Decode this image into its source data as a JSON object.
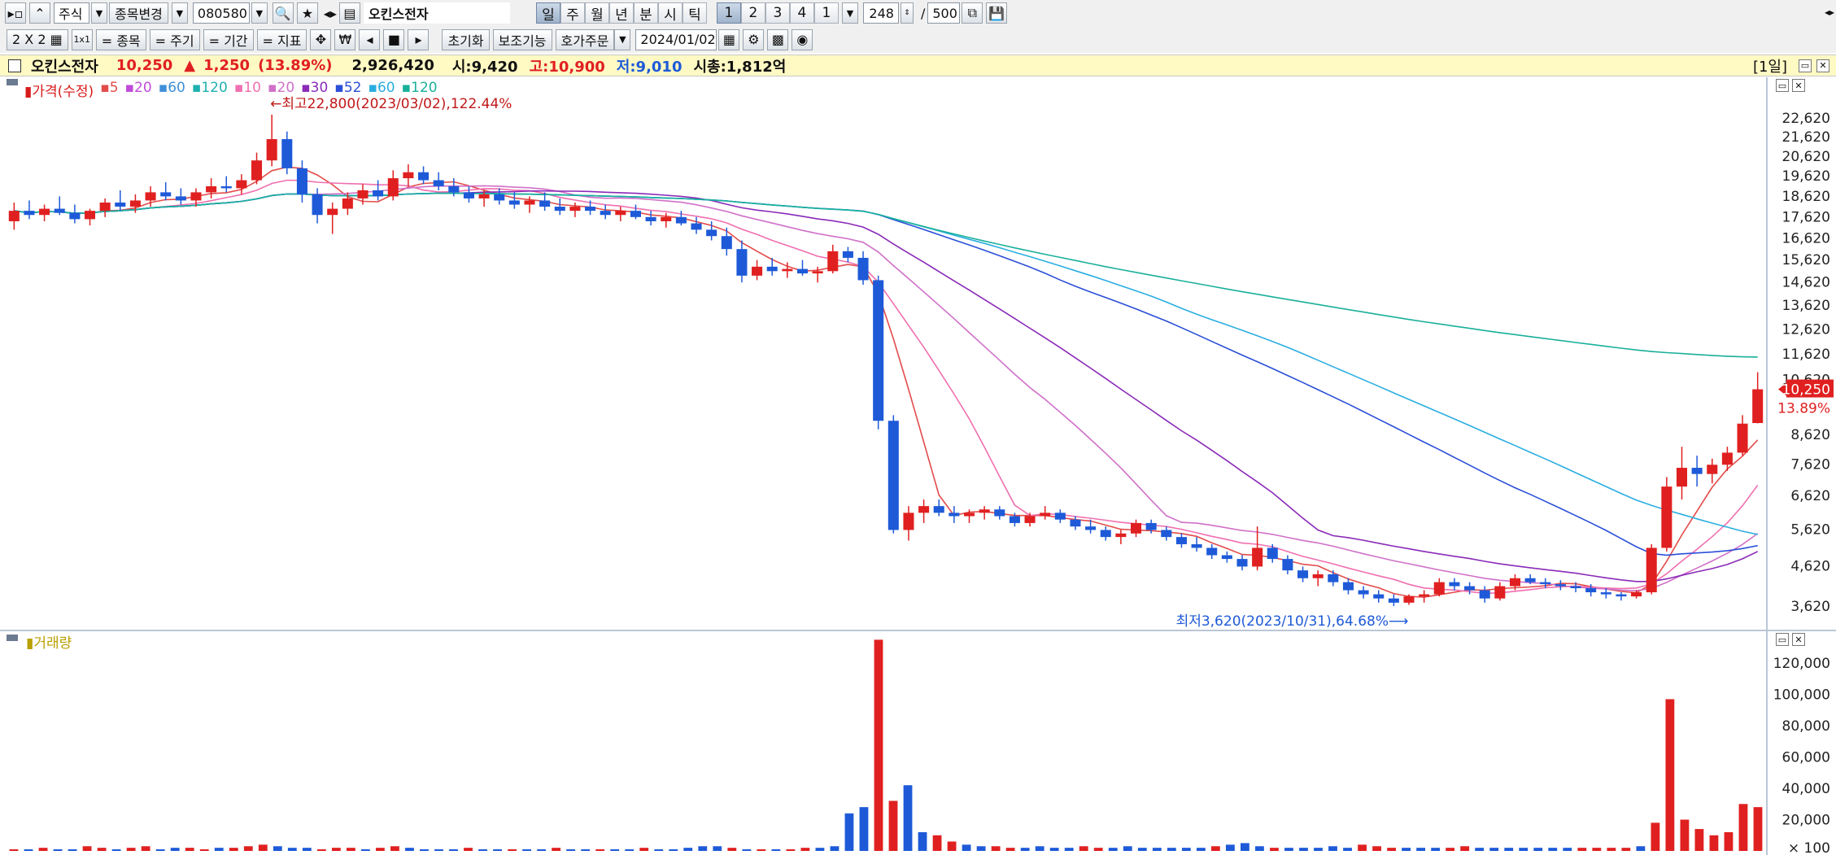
{
  "toolbar1": {
    "market": "주식",
    "change_label": "종목변경",
    "code": "080580",
    "stock_name": "오킨스전자",
    "periods": [
      "일",
      "주",
      "월",
      "년",
      "분",
      "시",
      "틱"
    ],
    "active_period": "일",
    "numbers": [
      "1",
      "2",
      "3",
      "4",
      "1"
    ],
    "active_number": "1",
    "count": "248",
    "slash": "/",
    "total": "500"
  },
  "toolbar2": {
    "layout_label": "2 X 2",
    "one_label": "1x1",
    "items": [
      "= 종목",
      "= 주기",
      "= 기간",
      "= 지표"
    ],
    "reset_label": "초기화",
    "aux_label": "보조기능",
    "order_label": "호가주문",
    "date": "2024/01/02"
  },
  "infobar": {
    "name": "오킨스전자",
    "price": "10,250",
    "arrow": "▲",
    "change": "1,250",
    "pct": "(13.89%)",
    "volume": "2,926,420",
    "open": "시:9,420",
    "high": "고:10,900",
    "low": "저:9,010",
    "mcap": "시총:1,812억",
    "period_tag": "[1일]"
  },
  "price_panel": {
    "legend": [
      {
        "text": "가격(수정)",
        "color": "#d81b1b"
      },
      {
        "text": "5",
        "color": "#e34b4b"
      },
      {
        "text": "20",
        "color": "#c04bd8"
      },
      {
        "text": "60",
        "color": "#3f8fd8"
      },
      {
        "text": "120",
        "color": "#20b0b0"
      },
      {
        "text": "10",
        "color": "#f06fb0"
      },
      {
        "text": "20",
        "color": "#d070c8"
      },
      {
        "text": "30",
        "color": "#8a2ab8"
      },
      {
        "text": "52",
        "color": "#2a4fd8"
      },
      {
        "text": "60",
        "color": "#2aaee0"
      },
      {
        "text": "120",
        "color": "#1ab09a"
      }
    ],
    "high_annotation": "최고22,800(2023/03/02),122.44%",
    "low_annotation": "최저3,620(2023/10/31),64.68%",
    "price_labels": [
      "22,620",
      "21,620",
      "20,620",
      "19,620",
      "18,620",
      "17,620",
      "16,620",
      "15,620",
      "14,620",
      "13,620",
      "12,620",
      "11,620",
      "10,620",
      "8,620",
      "7,620",
      "6,620",
      "5,620",
      "4,620",
      "3,620"
    ],
    "current_price": "10,250",
    "current_pct": "13.89%"
  },
  "volume_panel": {
    "title": "거래량",
    "labels": [
      "120,000",
      "100,000",
      "80,000",
      "60,000",
      "40,000",
      "20,000"
    ],
    "unit": "× 100"
  },
  "colors": {
    "up": "#e02020",
    "down": "#1e5ad8",
    "infobar_bg": "#fff9c4",
    "toolbar_bg": "#f0f0f0"
  },
  "chart_data": {
    "type": "candlestick",
    "candles": [
      {
        "o": 17400,
        "h": 18300,
        "l": 17000,
        "c": 17900
      },
      {
        "o": 17900,
        "h": 18400,
        "l": 17500,
        "c": 17700
      },
      {
        "o": 17700,
        "h": 18200,
        "l": 17400,
        "c": 18000
      },
      {
        "o": 18000,
        "h": 18600,
        "l": 17700,
        "c": 17800
      },
      {
        "o": 17800,
        "h": 18200,
        "l": 17300,
        "c": 17500
      },
      {
        "o": 17500,
        "h": 18000,
        "l": 17200,
        "c": 17900
      },
      {
        "o": 17900,
        "h": 18500,
        "l": 17600,
        "c": 18300
      },
      {
        "o": 18300,
        "h": 18900,
        "l": 17900,
        "c": 18100
      },
      {
        "o": 18100,
        "h": 18700,
        "l": 17800,
        "c": 18400
      },
      {
        "o": 18400,
        "h": 19100,
        "l": 18100,
        "c": 18800
      },
      {
        "o": 18800,
        "h": 19300,
        "l": 18400,
        "c": 18600
      },
      {
        "o": 18600,
        "h": 19000,
        "l": 18200,
        "c": 18400
      },
      {
        "o": 18400,
        "h": 19000,
        "l": 18100,
        "c": 18800
      },
      {
        "o": 18800,
        "h": 19500,
        "l": 18500,
        "c": 19100
      },
      {
        "o": 19100,
        "h": 19600,
        "l": 18800,
        "c": 19000
      },
      {
        "o": 19000,
        "h": 19700,
        "l": 18700,
        "c": 19400
      },
      {
        "o": 19400,
        "h": 20800,
        "l": 19200,
        "c": 20400
      },
      {
        "o": 20400,
        "h": 22800,
        "l": 20100,
        "c": 21500
      },
      {
        "o": 21500,
        "h": 21900,
        "l": 19700,
        "c": 20000
      },
      {
        "o": 20000,
        "h": 20400,
        "l": 18300,
        "c": 18700
      },
      {
        "o": 18700,
        "h": 19000,
        "l": 17300,
        "c": 17700
      },
      {
        "o": 17700,
        "h": 18300,
        "l": 16800,
        "c": 18000
      },
      {
        "o": 18000,
        "h": 18800,
        "l": 17700,
        "c": 18500
      },
      {
        "o": 18500,
        "h": 19200,
        "l": 18200,
        "c": 18900
      },
      {
        "o": 18900,
        "h": 19400,
        "l": 18400,
        "c": 18600
      },
      {
        "o": 18600,
        "h": 19900,
        "l": 18400,
        "c": 19500
      },
      {
        "o": 19500,
        "h": 20200,
        "l": 19100,
        "c": 19800
      },
      {
        "o": 19800,
        "h": 20100,
        "l": 19200,
        "c": 19400
      },
      {
        "o": 19400,
        "h": 19800,
        "l": 18900,
        "c": 19100
      },
      {
        "o": 19100,
        "h": 19500,
        "l": 18600,
        "c": 18800
      },
      {
        "o": 18800,
        "h": 19100,
        "l": 18300,
        "c": 18500
      },
      {
        "o": 18500,
        "h": 18900,
        "l": 18100,
        "c": 18700
      },
      {
        "o": 18700,
        "h": 19000,
        "l": 18200,
        "c": 18400
      },
      {
        "o": 18400,
        "h": 18800,
        "l": 18000,
        "c": 18200
      },
      {
        "o": 18200,
        "h": 18600,
        "l": 17800,
        "c": 18400
      },
      {
        "o": 18400,
        "h": 18800,
        "l": 17900,
        "c": 18100
      },
      {
        "o": 18100,
        "h": 18500,
        "l": 17700,
        "c": 17900
      },
      {
        "o": 17900,
        "h": 18300,
        "l": 17600,
        "c": 18100
      },
      {
        "o": 18100,
        "h": 18400,
        "l": 17700,
        "c": 17900
      },
      {
        "o": 17900,
        "h": 18200,
        "l": 17500,
        "c": 17700
      },
      {
        "o": 17700,
        "h": 18100,
        "l": 17400,
        "c": 17900
      },
      {
        "o": 17900,
        "h": 18200,
        "l": 17500,
        "c": 17600
      },
      {
        "o": 17600,
        "h": 17900,
        "l": 17200,
        "c": 17400
      },
      {
        "o": 17400,
        "h": 17800,
        "l": 17100,
        "c": 17600
      },
      {
        "o": 17600,
        "h": 17900,
        "l": 17200,
        "c": 17300
      },
      {
        "o": 17300,
        "h": 17600,
        "l": 16800,
        "c": 17000
      },
      {
        "o": 17000,
        "h": 17400,
        "l": 16500,
        "c": 16700
      },
      {
        "o": 16700,
        "h": 17100,
        "l": 15800,
        "c": 16100
      },
      {
        "o": 16100,
        "h": 16500,
        "l": 14600,
        "c": 14900
      },
      {
        "o": 14900,
        "h": 15600,
        "l": 14700,
        "c": 15300
      },
      {
        "o": 15300,
        "h": 15700,
        "l": 14900,
        "c": 15100
      },
      {
        "o": 15100,
        "h": 15500,
        "l": 14800,
        "c": 15200
      },
      {
        "o": 15200,
        "h": 15600,
        "l": 14900,
        "c": 15000
      },
      {
        "o": 15000,
        "h": 15300,
        "l": 14600,
        "c": 15100
      },
      {
        "o": 15100,
        "h": 16300,
        "l": 15000,
        "c": 16000
      },
      {
        "o": 16000,
        "h": 16200,
        "l": 15500,
        "c": 15700
      },
      {
        "o": 15700,
        "h": 16000,
        "l": 14500,
        "c": 14700
      },
      {
        "o": 14700,
        "h": 14900,
        "l": 8800,
        "c": 9100
      },
      {
        "o": 9100,
        "h": 9300,
        "l": 5500,
        "c": 5600
      },
      {
        "o": 5600,
        "h": 6300,
        "l": 5300,
        "c": 6100
      },
      {
        "o": 6100,
        "h": 6500,
        "l": 5800,
        "c": 6300
      },
      {
        "o": 6300,
        "h": 6500,
        "l": 6000,
        "c": 6100
      },
      {
        "o": 6100,
        "h": 6300,
        "l": 5800,
        "c": 6000
      },
      {
        "o": 6000,
        "h": 6200,
        "l": 5800,
        "c": 6100
      },
      {
        "o": 6100,
        "h": 6300,
        "l": 5900,
        "c": 6200
      },
      {
        "o": 6200,
        "h": 6300,
        "l": 5900,
        "c": 6000
      },
      {
        "o": 6000,
        "h": 6100,
        "l": 5700,
        "c": 5800
      },
      {
        "o": 5800,
        "h": 6100,
        "l": 5700,
        "c": 6000
      },
      {
        "o": 6000,
        "h": 6300,
        "l": 5900,
        "c": 6100
      },
      {
        "o": 6100,
        "h": 6200,
        "l": 5800,
        "c": 5900
      },
      {
        "o": 5900,
        "h": 6000,
        "l": 5600,
        "c": 5700
      },
      {
        "o": 5700,
        "h": 5900,
        "l": 5500,
        "c": 5600
      },
      {
        "o": 5600,
        "h": 5700,
        "l": 5300,
        "c": 5400
      },
      {
        "o": 5400,
        "h": 5600,
        "l": 5200,
        "c": 5500
      },
      {
        "o": 5500,
        "h": 5900,
        "l": 5400,
        "c": 5800
      },
      {
        "o": 5800,
        "h": 5900,
        "l": 5500,
        "c": 5600
      },
      {
        "o": 5600,
        "h": 5700,
        "l": 5300,
        "c": 5400
      },
      {
        "o": 5400,
        "h": 5500,
        "l": 5100,
        "c": 5200
      },
      {
        "o": 5200,
        "h": 5400,
        "l": 5000,
        "c": 5100
      },
      {
        "o": 5100,
        "h": 5200,
        "l": 4800,
        "c": 4900
      },
      {
        "o": 4900,
        "h": 5000,
        "l": 4700,
        "c": 4800
      },
      {
        "o": 4800,
        "h": 4900,
        "l": 4500,
        "c": 4600
      },
      {
        "o": 4600,
        "h": 5700,
        "l": 4500,
        "c": 5100
      },
      {
        "o": 5100,
        "h": 5200,
        "l": 4700,
        "c": 4800
      },
      {
        "o": 4800,
        "h": 4900,
        "l": 4400,
        "c": 4500
      },
      {
        "o": 4500,
        "h": 4600,
        "l": 4200,
        "c": 4300
      },
      {
        "o": 4300,
        "h": 4500,
        "l": 4100,
        "c": 4400
      },
      {
        "o": 4400,
        "h": 4500,
        "l": 4100,
        "c": 4200
      },
      {
        "o": 4200,
        "h": 4300,
        "l": 3900,
        "c": 4000
      },
      {
        "o": 4000,
        "h": 4100,
        "l": 3800,
        "c": 3900
      },
      {
        "o": 3900,
        "h": 4000,
        "l": 3700,
        "c": 3800
      },
      {
        "o": 3800,
        "h": 3900,
        "l": 3620,
        "c": 3700
      },
      {
        "o": 3700,
        "h": 3900,
        "l": 3650,
        "c": 3850
      },
      {
        "o": 3850,
        "h": 4000,
        "l": 3700,
        "c": 3900
      },
      {
        "o": 3900,
        "h": 4300,
        "l": 3850,
        "c": 4200
      },
      {
        "o": 4200,
        "h": 4300,
        "l": 4000,
        "c": 4100
      },
      {
        "o": 4100,
        "h": 4200,
        "l": 3900,
        "c": 4000
      },
      {
        "o": 4000,
        "h": 4100,
        "l": 3700,
        "c": 3800
      },
      {
        "o": 3800,
        "h": 4200,
        "l": 3750,
        "c": 4100
      },
      {
        "o": 4100,
        "h": 4400,
        "l": 4000,
        "c": 4300
      },
      {
        "o": 4300,
        "h": 4400,
        "l": 4150,
        "c": 4200
      },
      {
        "o": 4200,
        "h": 4300,
        "l": 4050,
        "c": 4150
      },
      {
        "o": 4150,
        "h": 4250,
        "l": 4000,
        "c": 4100
      },
      {
        "o": 4100,
        "h": 4200,
        "l": 3950,
        "c": 4050
      },
      {
        "o": 4050,
        "h": 4150,
        "l": 3850,
        "c": 3950
      },
      {
        "o": 3950,
        "h": 4050,
        "l": 3800,
        "c": 3900
      },
      {
        "o": 3900,
        "h": 3950,
        "l": 3750,
        "c": 3850
      },
      {
        "o": 3850,
        "h": 4000,
        "l": 3800,
        "c": 3950
      },
      {
        "o": 3950,
        "h": 5200,
        "l": 3900,
        "c": 5100
      },
      {
        "o": 5100,
        "h": 7200,
        "l": 5000,
        "c": 6900
      },
      {
        "o": 6900,
        "h": 8200,
        "l": 6500,
        "c": 7500
      },
      {
        "o": 7500,
        "h": 7900,
        "l": 6900,
        "c": 7300
      },
      {
        "o": 7300,
        "h": 7800,
        "l": 7000,
        "c": 7600
      },
      {
        "o": 7600,
        "h": 8200,
        "l": 7400,
        "c": 8000
      },
      {
        "o": 8000,
        "h": 9300,
        "l": 7900,
        "c": 9000
      },
      {
        "o": 9020,
        "h": 10900,
        "l": 9010,
        "c": 10250
      }
    ],
    "volumes_x100": [
      1,
      1,
      2,
      1,
      1,
      3,
      2,
      1,
      2,
      3,
      1,
      2,
      2,
      1,
      2,
      2,
      3,
      4,
      3,
      2,
      2,
      1,
      2,
      2,
      1,
      2,
      3,
      2,
      1,
      1,
      1,
      2,
      1,
      1,
      1,
      1,
      1,
      2,
      1,
      1,
      1,
      1,
      1,
      2,
      1,
      1,
      2,
      3,
      3,
      2,
      1,
      1,
      1,
      1,
      2,
      2,
      3,
      24,
      28,
      135,
      32,
      42,
      12,
      10,
      6,
      4,
      3,
      3,
      2,
      2,
      3,
      2,
      2,
      3,
      2,
      2,
      3,
      2,
      2,
      2,
      2,
      2,
      3,
      4,
      5,
      3,
      2,
      2,
      2,
      2,
      3,
      2,
      4,
      3,
      2,
      2,
      2,
      2,
      2,
      3,
      2,
      2,
      2,
      2,
      2,
      2,
      2,
      2,
      2,
      2,
      2,
      3,
      18,
      97,
      20,
      14,
      10,
      12,
      30,
      28
    ],
    "y_range": [
      3620,
      22620
    ],
    "volume_range": [
      0,
      130000
    ]
  }
}
